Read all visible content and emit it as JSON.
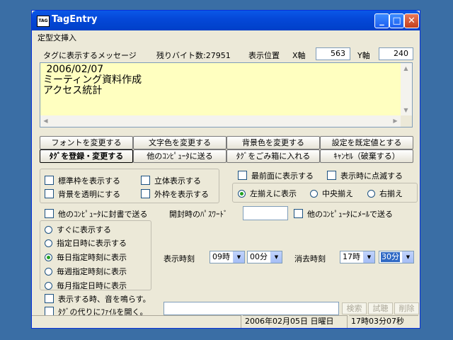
{
  "window": {
    "title": "TagEntry",
    "icon": "app-icon"
  },
  "menu": {
    "items": [
      "定型文挿入"
    ]
  },
  "message": {
    "label": "タグに表示するメッセージ",
    "remaining_label": "残りバイト数:27951",
    "position_label": "表示位置",
    "x_label": "X軸",
    "x_value": "563",
    "y_label": "Y軸",
    "y_value": "240",
    "text": " 2006/02/07\nミーティング資料作成\nアクセス統計"
  },
  "buttons": {
    "font": "フォントを変更する",
    "text_color": "文字色を変更する",
    "bg_color": "背景色を変更する",
    "default": "設定を既定値とする",
    "register": "ﾀｸﾞを登録・変更する",
    "send": "他のｺﾝﾋﾟｭｰﾀに送る",
    "trash": "ﾀｸﾞをごみ箱に入れる",
    "cancel": "ｷｬﾝｾﾙ（破棄する）"
  },
  "options": {
    "standard_frame": "標準枠を表示する",
    "three_d": "立体表示する",
    "transparent_bg": "背景を透明にする",
    "outer_frame": "外枠を表示する",
    "topmost": "最前面に表示する",
    "blink": "表示時に点滅する",
    "align_left": "左揃えに表示",
    "align_center": "中央揃え",
    "align_right": "右揃え"
  },
  "send": {
    "sealed": "他のｺﾝﾋﾟｭｰﾀに封書で送る",
    "password_label": "開封時のﾊﾟｽﾜｰﾄﾞ",
    "mail": "他のｺﾝﾋﾟｭｰﾀにﾒｰﾙで送る"
  },
  "schedule": {
    "immediate": "すぐに表示する",
    "date_time": "指定日時に表示する",
    "daily": "毎日指定時刻に表示",
    "weekly": "毎週指定時刻に表示",
    "monthly": "毎月指定日時に表示",
    "selected": "daily"
  },
  "times": {
    "show_label": "表示時刻",
    "show_hour": "09時",
    "show_min": "00分",
    "erase_label": "消去時刻",
    "erase_hour": "17時",
    "erase_min": "30分"
  },
  "extra": {
    "sound": "表示する時、音を鳴らす。",
    "open_file": "ﾀｸﾞの代りにﾌｧｲﾙを開く。",
    "search": "検索",
    "trial": "試聴",
    "delete": "削除"
  },
  "status": {
    "date": "2006年02月05日 日曜日",
    "time": "17時03分07秒"
  },
  "colors": {
    "memo_bg": "#ffffc0",
    "title_bar": "#0548d8"
  }
}
